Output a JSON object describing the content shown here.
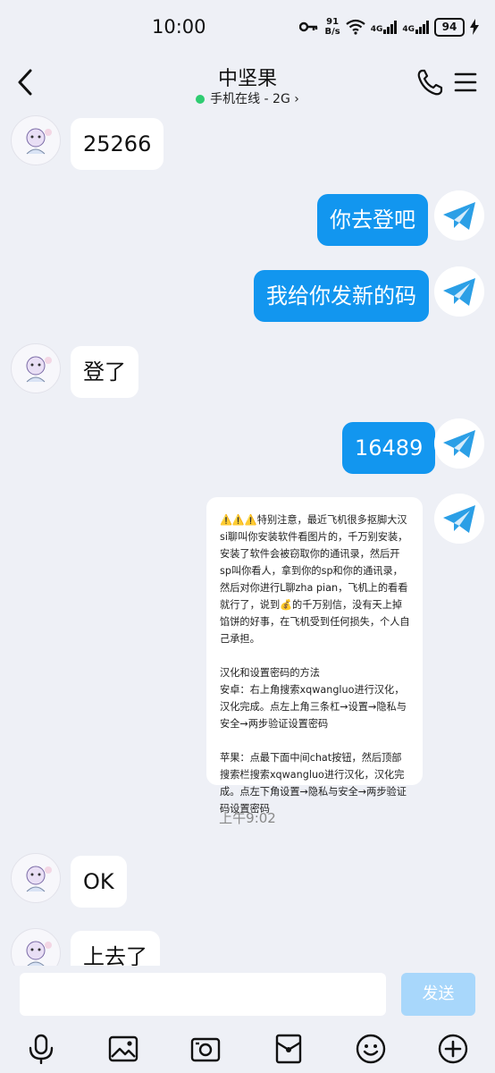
{
  "status_bar": {
    "time": "10:00",
    "speed_value": "91",
    "speed_unit": "B/s",
    "network_1": "4G",
    "network_2": "4G",
    "battery": "94",
    "icons": [
      "key-icon",
      "wifi-icon",
      "signal-icon",
      "charging-icon"
    ]
  },
  "header": {
    "title": "中坚果",
    "subtitle": "手机在线 - 2G",
    "chevron": "›",
    "status_color": "#2ecc71"
  },
  "messages": {
    "m1": "25266",
    "m2": "你去登吧",
    "m3": "我给你发新的码",
    "m4": "登了",
    "m5": "16489",
    "card_text": "⚠️⚠️⚠️特别注意，最近飞机很多抠脚大汉si聊叫你安装软件看图片的，千万别安装，安装了软件会被窃取你的通讯录，然后开sp叫你看人，拿到你的sp和你的通讯录，然后对你进行L聊zha pian，飞机上的看看就行了，说到💰的千万别信，没有天上掉馅饼的好事，在飞机受到任何损失，个人自己承担。\n\n汉化和设置密码的方法\n安卓：右上角搜索xqwangluo进行汉化，汉化完成。点左上角三条杠→设置→隐私与安全→两步验证设置密码\n\n苹果：点最下面中间chat按钮，然后顶部搜索栏搜索xqwangluo进行汉化，汉化完成。点左下角设置→隐私与安全→两步验证码设置密码",
    "timestamp": "上午9:02",
    "m6": "OK",
    "m7": "上去了"
  },
  "input": {
    "placeholder": "",
    "send_label": "发送"
  },
  "toolbar_icons": [
    "microphone-icon",
    "image-icon",
    "camera-icon",
    "red-packet-icon",
    "emoji-icon",
    "plus-icon"
  ],
  "colors": {
    "background": "#eef0f6",
    "outgoing_bubble": "#1296ef",
    "send_button": "#a8d7fb"
  }
}
